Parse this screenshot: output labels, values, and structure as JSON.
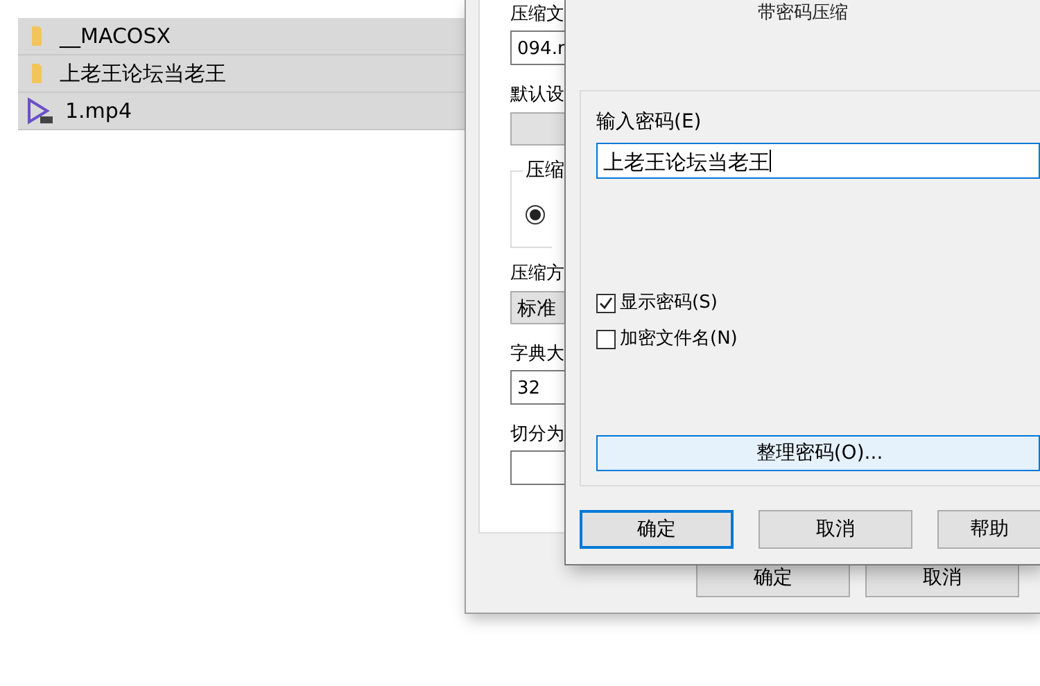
{
  "file_list": [
    {
      "name": "__MACOSX",
      "kind": "folder"
    },
    {
      "name": "上老王论坛当老王",
      "kind": "folder"
    },
    {
      "name": "1.mp4",
      "kind": "video"
    }
  ],
  "back_dialog": {
    "fields": [
      {
        "label": "压缩文",
        "kind": "input",
        "value": "094.r"
      },
      {
        "label": "默认设",
        "kind": "button"
      },
      {
        "label": "压缩",
        "kind": "group",
        "checked": true
      },
      {
        "label": "压缩方",
        "kind": "select",
        "value": "标准"
      },
      {
        "label": "字典大",
        "kind": "input",
        "value": "32"
      },
      {
        "label": "切分为",
        "kind": "input"
      }
    ],
    "buttons": [
      "确定",
      "取消"
    ]
  },
  "password_dialog": {
    "title": "带密码压缩",
    "password_label": "输入密码(E)",
    "password": "上老王论坛当老王",
    "options": [
      {
        "label": "显示密码(S)",
        "checked": true
      },
      {
        "label": "加密文件名(N)",
        "checked": false
      }
    ],
    "manage_button": "整理密码(O)...",
    "buttons": [
      {
        "label": "确定",
        "default": true
      },
      {
        "label": "取消",
        "default": false
      },
      {
        "label": "帮助",
        "default": false
      }
    ]
  }
}
